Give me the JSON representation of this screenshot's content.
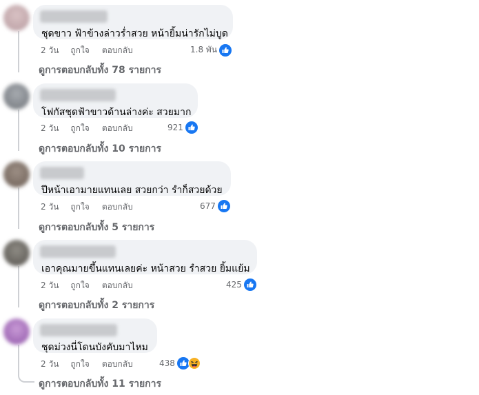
{
  "ui": {
    "like_color": "#1877f2",
    "comment_bg": "#f0f2f5",
    "meta_text_color": "#65676b"
  },
  "comments": [
    {
      "text": "ชุดขาว ฟ้าข้างล่าวร่ำสวย หน้ายิ้มน่ารักไม่บูด",
      "time": "2 วัน",
      "like_label": "ถูกใจ",
      "reply_label": "ตอบกลับ",
      "reaction_count": "1.8 พัน",
      "replies_label": "ดูการตอบกลับทั้ง 78 รายการ",
      "reactions": [
        "like-icon"
      ]
    },
    {
      "text": "โฟกัสชุดฟ้าขาวด้านล่างค่ะ สวยมาก",
      "time": "2 วัน",
      "like_label": "ถูกใจ",
      "reply_label": "ตอบกลับ",
      "reaction_count": "921",
      "replies_label": "ดูการตอบกลับทั้ง 10 รายการ",
      "reactions": [
        "like-icon"
      ]
    },
    {
      "text": "ปีหน้าเอามายแทนเลย สวยกว่า รำก็สวยด้วย",
      "time": "2 วัน",
      "like_label": "ถูกใจ",
      "reply_label": "ตอบกลับ",
      "reaction_count": "677",
      "replies_label": "ดูการตอบกลับทั้ง 5 รายการ",
      "reactions": [
        "like-icon"
      ]
    },
    {
      "text": "เอาคุณมายขึ้นแทนเลยค่ะ หน้าสวย รำสวย ยิ้มแย้ม",
      "time": "2 วัน",
      "like_label": "ถูกใจ",
      "reply_label": "ตอบกลับ",
      "reaction_count": "425",
      "replies_label": "ดูการตอบกลับทั้ง 2 รายการ",
      "reactions": [
        "like-icon"
      ]
    },
    {
      "text": "ชุดม่วงนี่โดนบังคับมาไหม",
      "time": "2 วัน",
      "like_label": "ถูกใจ",
      "reply_label": "ตอบกลับ",
      "reaction_count": "438",
      "replies_label": "ดูการตอบกลับทั้ง 11 รายการ",
      "reactions": [
        "like-icon",
        "haha-icon"
      ]
    }
  ]
}
